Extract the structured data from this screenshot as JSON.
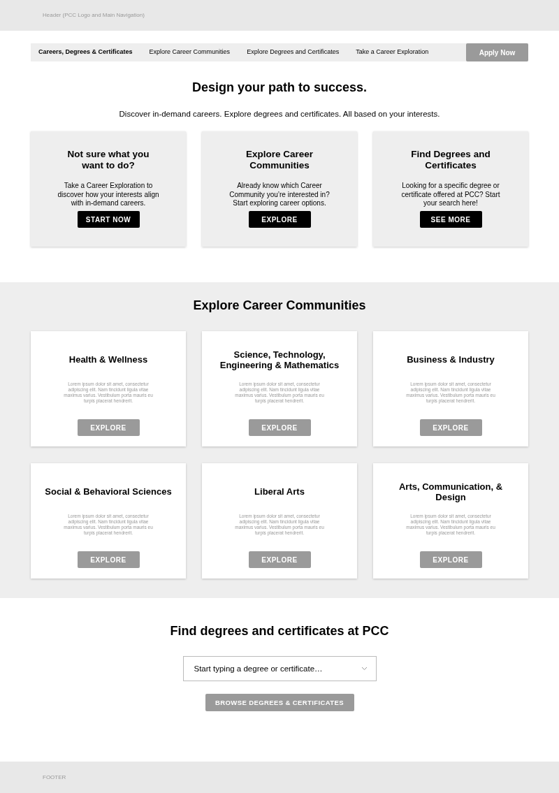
{
  "header": {
    "text": "Header (PCC Logo and Main Navigation)"
  },
  "subnav": {
    "items": [
      {
        "label": "Careers, Degrees & Certificates",
        "selected": true
      },
      {
        "label": "Explore Career Communities",
        "selected": false
      },
      {
        "label": "Explore Degrees and Certificates",
        "selected": false
      },
      {
        "label": "Take a Career Exploration",
        "selected": false
      }
    ],
    "cta": "Apply Now"
  },
  "hero": {
    "title": "Design your path to success.",
    "subtitle": "Discover in-demand careers. Explore degrees and certificates. All based on your interests.",
    "cards": [
      {
        "title": "Not sure what you want to do?",
        "text": "Take a Career Exploration to discover how your interests align with in-demand careers.",
        "button": "START NOW"
      },
      {
        "title": "Explore Career Communities",
        "text": "Already know which Career Community you’re interested in? Start exploring career options.",
        "button": "EXPLORE"
      },
      {
        "title": "Find Degrees and Certificates",
        "text": "Looking for a specific degree or certificate offered at PCC? Start your search here!",
        "button": "SEE MORE"
      }
    ]
  },
  "communities": {
    "title": "Explore Career Communities",
    "cards": [
      {
        "title": "Health & Wellness",
        "text": "Lorem ipsum dolor sit amet, consectetur adipiscing elit. Nam tincidunt ligula vitae maximus varius. Vestibulum porta mauris eu turpis placerat hendrerit.",
        "button": "EXPLORE"
      },
      {
        "title": "Science, Technology, Engineering & Mathematics",
        "text": "Lorem ipsum dolor sit amet, consectetur adipiscing elit. Nam tincidunt ligula vitae maximus varius. Vestibulum porta mauris eu turpis placerat hendrerit.",
        "button": "EXPLORE"
      },
      {
        "title": "Business & Industry",
        "text": "Lorem ipsum dolor sit amet, consectetur adipiscing elit. Nam tincidunt ligula vitae maximus varius. Vestibulum porta mauris eu turpis placerat hendrerit.",
        "button": "EXPLORE"
      },
      {
        "title": "Social & Behavioral Sciences",
        "text": "Lorem ipsum dolor sit amet, consectetur adipiscing elit. Nam tincidunt ligula vitae maximus varius. Vestibulum porta mauris eu turpis placerat hendrerit.",
        "button": "EXPLORE"
      },
      {
        "title": "Liberal Arts",
        "text": "Lorem ipsum dolor sit amet, consectetur adipiscing elit. Nam tincidunt ligula vitae maximus varius. Vestibulum porta mauris eu turpis placerat hendrerit.",
        "button": "EXPLORE"
      },
      {
        "title": "Arts, Communication, & Design",
        "text": "Lorem ipsum dolor sit amet, consectetur adipiscing elit. Nam tincidunt ligula vitae maximus varius. Vestibulum porta mauris eu turpis placerat hendrerit.",
        "button": "EXPLORE"
      }
    ]
  },
  "finder": {
    "title": "Find degrees and certificates at PCC",
    "placeholder": "Start typing a degree or certificate…",
    "button": "BROWSE DEGREES & CERTIFICATES"
  },
  "footer": {
    "text": "FOOTER"
  }
}
